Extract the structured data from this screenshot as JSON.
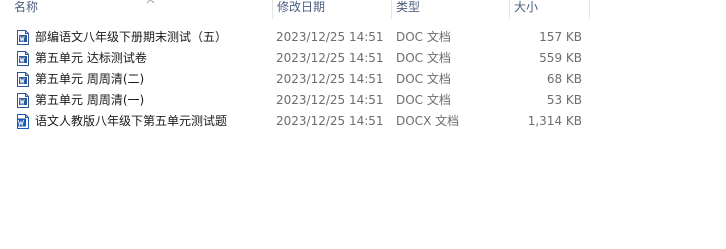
{
  "columns": {
    "name": "名称",
    "date": "修改日期",
    "type": "类型",
    "size": "大小"
  },
  "files": [
    {
      "name": "部编语文八年级下册期末测试（五）",
      "date": "2023/12/25 14:51",
      "type": "DOC 文档",
      "size": "157 KB",
      "icon": "word-doc-icon"
    },
    {
      "name": "第五单元 达标测试卷",
      "date": "2023/12/25 14:51",
      "type": "DOC 文档",
      "size": "559 KB",
      "icon": "word-doc-icon"
    },
    {
      "name": "第五单元 周周清(二)",
      "date": "2023/12/25 14:51",
      "type": "DOC 文档",
      "size": "68 KB",
      "icon": "word-doc-icon"
    },
    {
      "name": "第五单元 周周清(一)",
      "date": "2023/12/25 14:51",
      "type": "DOC 文档",
      "size": "53 KB",
      "icon": "word-doc-icon"
    },
    {
      "name": "语文人教版八年级下第五单元测试题",
      "date": "2023/12/25 14:51",
      "type": "DOCX 文档",
      "size": "1,314 KB",
      "icon": "word-docx-icon"
    }
  ],
  "colors": {
    "header_text": "#4d6082",
    "doc_icon_blue": "#2b579a",
    "docx_icon_blue": "#185abd"
  }
}
